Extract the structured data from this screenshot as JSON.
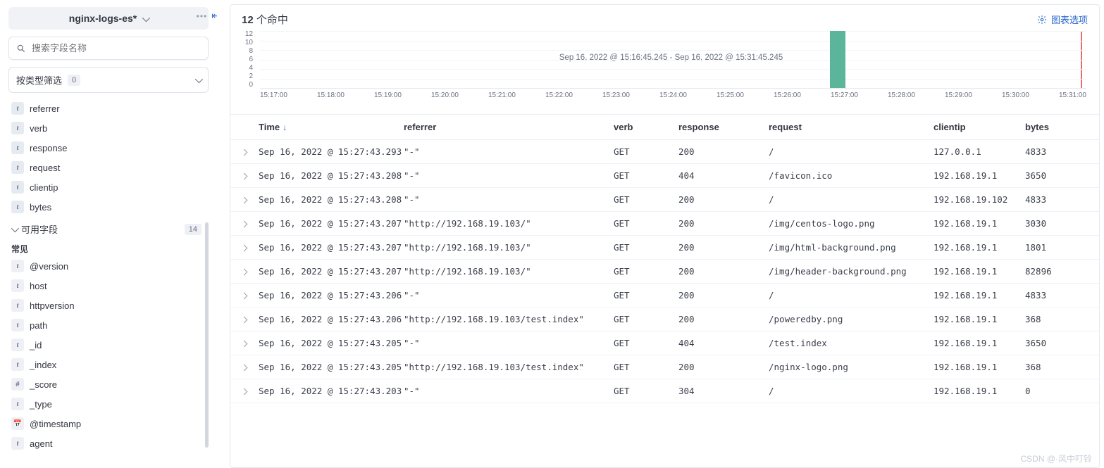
{
  "sidebar": {
    "pattern": "nginx-logs-es*",
    "search_placeholder": "搜索字段名称",
    "filter_type_label": "按类型筛选",
    "filter_type_count": "0",
    "selected_fields": [
      {
        "type": "t",
        "name": "referrer"
      },
      {
        "type": "t",
        "name": "verb"
      },
      {
        "type": "t",
        "name": "response"
      },
      {
        "type": "t",
        "name": "request"
      },
      {
        "type": "t",
        "name": "clientip"
      },
      {
        "type": "t",
        "name": "bytes"
      }
    ],
    "available_header": "可用字段",
    "available_count": "14",
    "common_header": "常见",
    "available_fields": [
      {
        "type": "t",
        "name": "@version"
      },
      {
        "type": "t",
        "name": "host"
      },
      {
        "type": "t",
        "name": "httpversion"
      },
      {
        "type": "t",
        "name": "path"
      },
      {
        "type": "t",
        "name": "_id"
      },
      {
        "type": "t",
        "name": "_index"
      },
      {
        "type": "#",
        "name": "_score"
      },
      {
        "type": "t",
        "name": "_type"
      },
      {
        "type": "d",
        "name": "@timestamp"
      },
      {
        "type": "t",
        "name": "agent"
      }
    ]
  },
  "header": {
    "hits_count": "12",
    "hits_label": " 个命中",
    "chart_options": "图表选项"
  },
  "chart_data": {
    "type": "bar",
    "title": "",
    "ylabel": "",
    "xlabel": "Sep 16, 2022 @ 15:16:45.245 - Sep 16, 2022 @ 15:31:45.245",
    "ylim": [
      0,
      12
    ],
    "y_ticks": [
      "12",
      "10",
      "8",
      "6",
      "4",
      "2",
      "0"
    ],
    "x_ticks": [
      "15:17:00",
      "15:18:00",
      "15:19:00",
      "15:20:00",
      "15:21:00",
      "15:22:00",
      "15:23:00",
      "15:24:00",
      "15:25:00",
      "15:26:00",
      "15:27:00",
      "15:28:00",
      "15:29:00",
      "15:30:00",
      "15:31:00"
    ],
    "series": [
      {
        "name": "count",
        "values": [
          0,
          0,
          0,
          0,
          0,
          0,
          0,
          0,
          0,
          0,
          12,
          0,
          0,
          0,
          0
        ]
      }
    ],
    "categories": [
      "15:17",
      "15:18",
      "15:19",
      "15:20",
      "15:21",
      "15:22",
      "15:23",
      "15:24",
      "15:25",
      "15:26",
      "15:27",
      "15:28",
      "15:29",
      "15:30",
      "15:31"
    ]
  },
  "table": {
    "columns": {
      "time": "Time",
      "referrer": "referrer",
      "verb": "verb",
      "response": "response",
      "request": "request",
      "clientip": "clientip",
      "bytes": "bytes"
    },
    "rows": [
      {
        "time": "Sep 16, 2022 @ 15:27:43.293",
        "referrer": "\"-\"",
        "verb": "GET",
        "response": "200",
        "request": "/",
        "clientip": "127.0.0.1",
        "bytes": "4833"
      },
      {
        "time": "Sep 16, 2022 @ 15:27:43.208",
        "referrer": "\"-\"",
        "verb": "GET",
        "response": "404",
        "request": "/favicon.ico",
        "clientip": "192.168.19.1",
        "bytes": "3650"
      },
      {
        "time": "Sep 16, 2022 @ 15:27:43.208",
        "referrer": "\"-\"",
        "verb": "GET",
        "response": "200",
        "request": "/",
        "clientip": "192.168.19.102",
        "bytes": "4833"
      },
      {
        "time": "Sep 16, 2022 @ 15:27:43.207",
        "referrer": "\"http://192.168.19.103/\"",
        "verb": "GET",
        "response": "200",
        "request": "/img/centos-logo.png",
        "clientip": "192.168.19.1",
        "bytes": "3030"
      },
      {
        "time": "Sep 16, 2022 @ 15:27:43.207",
        "referrer": "\"http://192.168.19.103/\"",
        "verb": "GET",
        "response": "200",
        "request": "/img/html-background.png",
        "clientip": "192.168.19.1",
        "bytes": "1801"
      },
      {
        "time": "Sep 16, 2022 @ 15:27:43.207",
        "referrer": "\"http://192.168.19.103/\"",
        "verb": "GET",
        "response": "200",
        "request": "/img/header-background.png",
        "clientip": "192.168.19.1",
        "bytes": "82896"
      },
      {
        "time": "Sep 16, 2022 @ 15:27:43.206",
        "referrer": "\"-\"",
        "verb": "GET",
        "response": "200",
        "request": "/",
        "clientip": "192.168.19.1",
        "bytes": "4833"
      },
      {
        "time": "Sep 16, 2022 @ 15:27:43.206",
        "referrer": "\"http://192.168.19.103/test.index\"",
        "verb": "GET",
        "response": "200",
        "request": "/poweredby.png",
        "clientip": "192.168.19.1",
        "bytes": "368"
      },
      {
        "time": "Sep 16, 2022 @ 15:27:43.205",
        "referrer": "\"-\"",
        "verb": "GET",
        "response": "404",
        "request": "/test.index",
        "clientip": "192.168.19.1",
        "bytes": "3650"
      },
      {
        "time": "Sep 16, 2022 @ 15:27:43.205",
        "referrer": "\"http://192.168.19.103/test.index\"",
        "verb": "GET",
        "response": "200",
        "request": "/nginx-logo.png",
        "clientip": "192.168.19.1",
        "bytes": "368"
      },
      {
        "time": "Sep 16, 2022 @ 15:27:43.203",
        "referrer": "\"-\"",
        "verb": "GET",
        "response": "304",
        "request": "/",
        "clientip": "192.168.19.1",
        "bytes": "0"
      }
    ]
  },
  "watermark": "CSDN @·风中叮铃"
}
